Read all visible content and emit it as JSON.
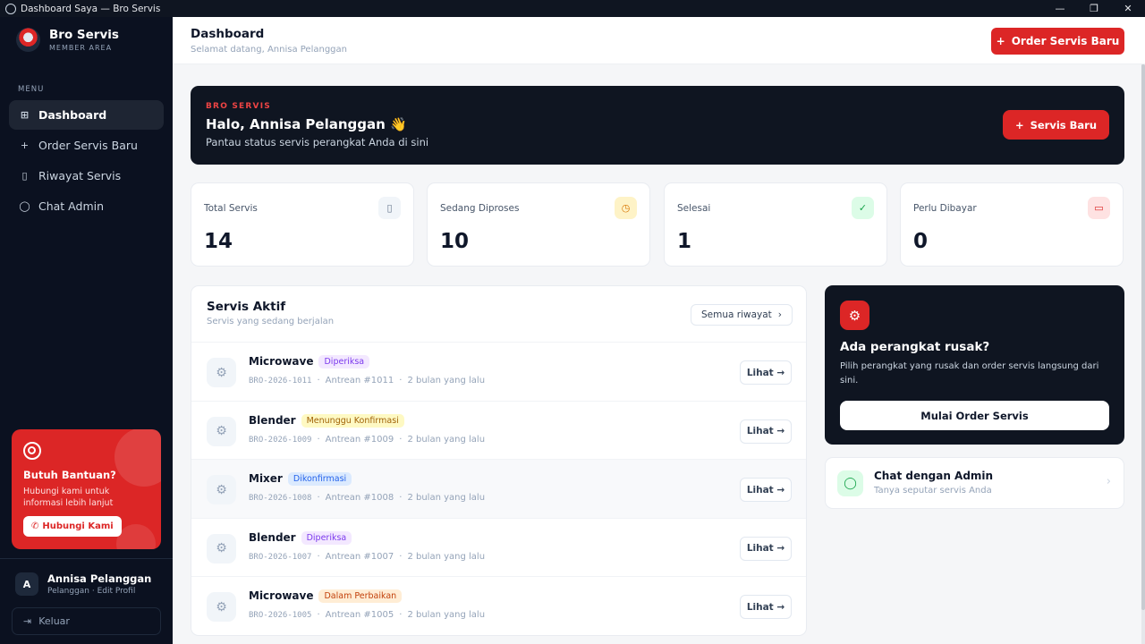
{
  "window": {
    "title": "Dashboard Saya — Bro Servis",
    "minimize": "—",
    "restore": "❐",
    "close": "✕"
  },
  "sidebar": {
    "brand_name": "Bro Servis",
    "brand_sub": "MEMBER AREA",
    "menu_label": "MENU",
    "items": [
      {
        "label": "Dashboard",
        "icon": "grid-icon",
        "active": true
      },
      {
        "label": "Order Servis Baru",
        "icon": "plus-icon"
      },
      {
        "label": "Riwayat Servis",
        "icon": "clipboard-icon"
      },
      {
        "label": "Chat Admin",
        "icon": "chat-icon"
      }
    ],
    "help": {
      "title": "Butuh Bantuan?",
      "text": "Hubungi kami untuk informasi lebih lanjut",
      "button": "Hubungi Kami"
    },
    "user": {
      "initial": "A",
      "name": "Annisa Pelanggan",
      "sub": "Pelanggan · Edit Profil"
    },
    "logout": "Keluar"
  },
  "header": {
    "title": "Dashboard",
    "subtitle": "Selamat datang, Annisa Pelanggan",
    "order_button": "Order Servis Baru"
  },
  "hero": {
    "kicker": "BRO SERVIS",
    "title": "Halo, Annisa Pelanggan 👋",
    "subtitle": "Pantau status servis perangkat Anda di sini",
    "button": "Servis Baru"
  },
  "stats": [
    {
      "label": "Total Servis",
      "value": "14",
      "icon": "clipboard-icon",
      "color": "#64748b",
      "bg": "#f1f5f9"
    },
    {
      "label": "Sedang Diproses",
      "value": "10",
      "icon": "clock-icon",
      "color": "#d97706",
      "bg": "#fef3c7"
    },
    {
      "label": "Selesai",
      "value": "1",
      "icon": "check-circle-icon",
      "color": "#16a34a",
      "bg": "#dcfce7"
    },
    {
      "label": "Perlu Dibayar",
      "value": "0",
      "icon": "card-icon",
      "color": "#dc2626",
      "bg": "#fee2e2"
    }
  ],
  "active": {
    "title": "Servis Aktif",
    "subtitle": "Servis yang sedang berjalan",
    "all_button": "Semua riwayat",
    "view_label": "Lihat →",
    "rows": [
      {
        "name": "Microwave",
        "status": "Diperiksa",
        "status_color": "#7c3aed",
        "status_bg": "#f3e8ff",
        "code": "BRO-2026-1011",
        "queue": "Antrean #1011",
        "time": "2 bulan yang lalu"
      },
      {
        "name": "Blender",
        "status": "Menunggu Konfirmasi",
        "status_color": "#a16207",
        "status_bg": "#fef9c3",
        "code": "BRO-2026-1009",
        "queue": "Antrean #1009",
        "time": "2 bulan yang lalu"
      },
      {
        "name": "Mixer",
        "status": "Dikonfirmasi",
        "status_color": "#2563eb",
        "status_bg": "#dbeafe",
        "code": "BRO-2026-1008",
        "queue": "Antrean #1008",
        "time": "2 bulan yang lalu"
      },
      {
        "name": "Blender",
        "status": "Diperiksa",
        "status_color": "#7c3aed",
        "status_bg": "#f3e8ff",
        "code": "BRO-2026-1007",
        "queue": "Antrean #1007",
        "time": "2 bulan yang lalu"
      },
      {
        "name": "Microwave",
        "status": "Dalam Perbaikan",
        "status_color": "#c2410c",
        "status_bg": "#ffedd5",
        "code": "BRO-2026-1005",
        "queue": "Antrean #1005",
        "time": "2 bulan yang lalu"
      }
    ]
  },
  "promo": {
    "title": "Ada perangkat rusak?",
    "text": "Pilih perangkat yang rusak dan order servis langsung dari sini.",
    "button": "Mulai Order Servis"
  },
  "chat": {
    "title": "Chat dengan Admin",
    "subtitle": "Tanya seputar servis Anda"
  },
  "colors": {
    "accent": "#dc2626",
    "dark": "#0f1521",
    "sidebar": "#0b1120"
  }
}
